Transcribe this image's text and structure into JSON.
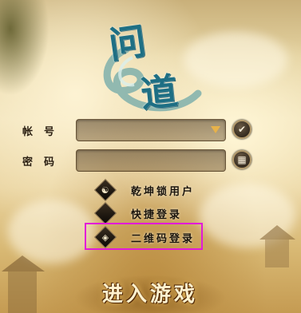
{
  "logo": {
    "char1": "问",
    "char2": "道"
  },
  "account": {
    "label": "帐号",
    "value": "",
    "placeholder": ""
  },
  "password": {
    "label": "密码",
    "value": "",
    "placeholder": ""
  },
  "confirm_icon": "✔",
  "keypad_icon": "▦",
  "options": [
    {
      "icon": "☯",
      "label": "乾坤锁用户"
    },
    {
      "icon": "",
      "label": "快捷登录"
    },
    {
      "icon": "◈",
      "label": "二维码登录"
    }
  ],
  "enter_button": {
    "label": "进入游戏"
  },
  "colors": {
    "highlight": "#e21ad8",
    "logo": "#1e6f84",
    "arrow": "#e7b24a"
  }
}
